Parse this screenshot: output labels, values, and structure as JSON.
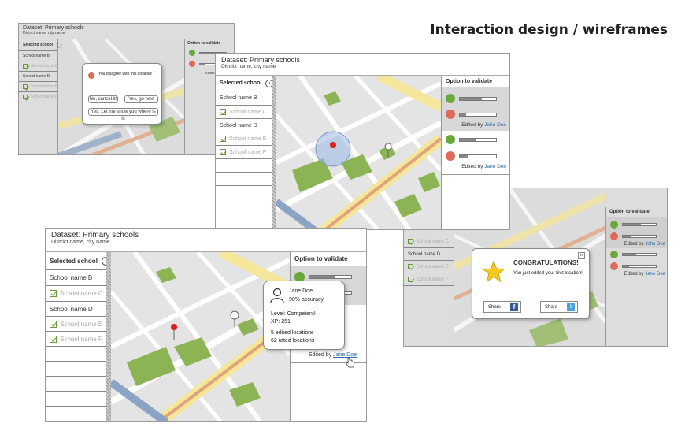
{
  "page_title": "Interaction design / wireframes",
  "wf": {
    "dataset_title": "Dataset: Primary schools",
    "district": "District name, city name",
    "selected_school": "Selected school",
    "schools": [
      "School name B",
      "School name C",
      "School name D",
      "School name E",
      "School name F"
    ],
    "option_header": "Option to validate",
    "edited_by": "Edited by",
    "editor1": "John Doe",
    "editor2": "Jane Doe"
  },
  "dialog": {
    "message": "You disagree with this location!",
    "cancel": "No, cancel it!",
    "next": "Yes, go next",
    "show": "Yes, Let me show you where is is"
  },
  "profile": {
    "name": "Jane Doe",
    "accuracy": "98% accuracy",
    "level": "Level: Competent!",
    "xp": "XP: 251",
    "edited": "5 edited locations",
    "rated": "62 rated locations"
  },
  "congrats": {
    "title": "CONGRATULATIONS!",
    "message": "You just edited your first location!",
    "share": "Share"
  },
  "colors": {
    "green": "#8cb454",
    "road": "#f4e79a",
    "river": "#8ba4c4",
    "accent": "#2b6cb0"
  }
}
